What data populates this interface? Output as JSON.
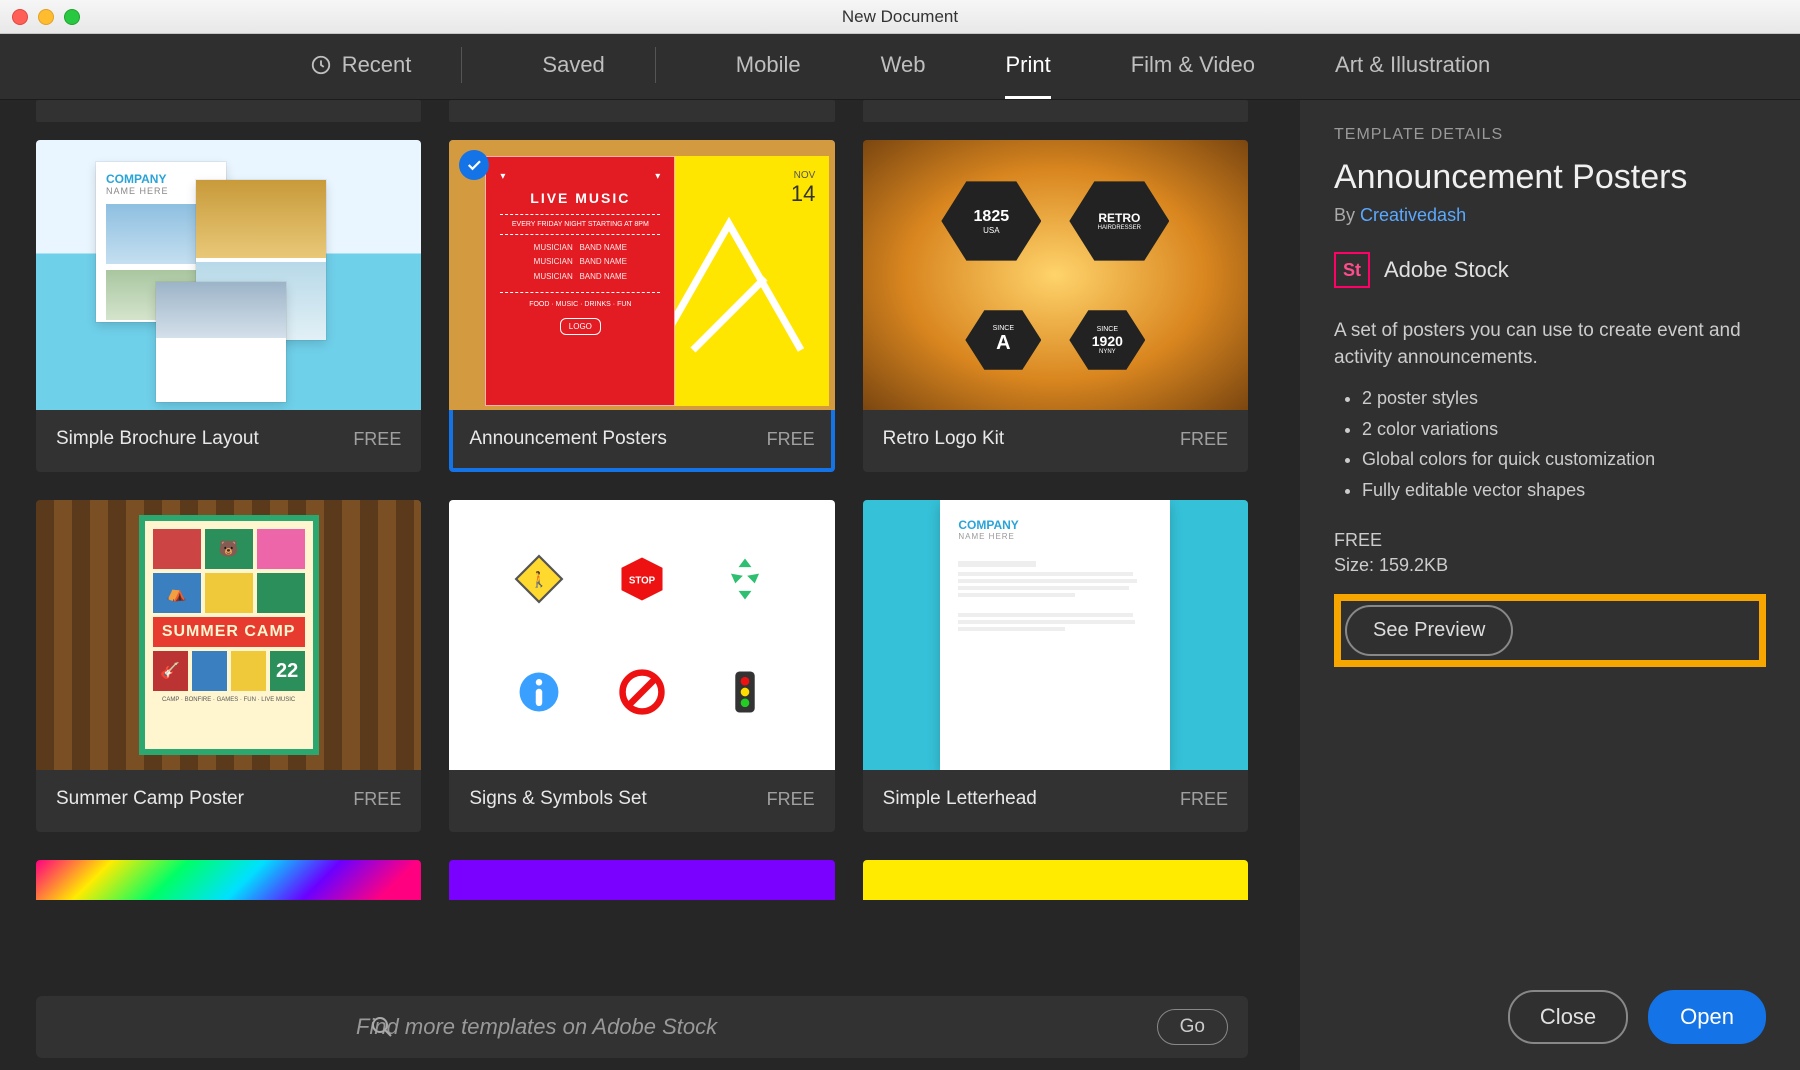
{
  "window": {
    "title": "New Document"
  },
  "tabs": {
    "recent": "Recent",
    "saved": "Saved",
    "mobile": "Mobile",
    "web": "Web",
    "print": "Print",
    "film": "Film & Video",
    "art": "Art & Illustration",
    "active": "print"
  },
  "templates": [
    {
      "id": "brochure",
      "name": "Simple Brochure Layout",
      "price": "FREE",
      "selected": false
    },
    {
      "id": "announce",
      "name": "Announcement Posters",
      "price": "FREE",
      "selected": true
    },
    {
      "id": "retro",
      "name": "Retro Logo Kit",
      "price": "FREE",
      "selected": false
    },
    {
      "id": "summer",
      "name": "Summer Camp Poster",
      "price": "FREE",
      "selected": false
    },
    {
      "id": "signs",
      "name": "Signs & Symbols Set",
      "price": "FREE",
      "selected": false
    },
    {
      "id": "letter",
      "name": "Simple Letterhead",
      "price": "FREE",
      "selected": false
    }
  ],
  "search": {
    "placeholder": "Find more templates on Adobe Stock",
    "go": "Go"
  },
  "details": {
    "heading": "TEMPLATE DETAILS",
    "title": "Announcement Posters",
    "by_prefix": "By ",
    "author": "Creativedash",
    "stock_label": "Adobe Stock",
    "stock_badge": "St",
    "description": "A set of posters you can use to create event and activity announcements.",
    "bullets": [
      "2 poster styles",
      "2 color variations",
      "Global colors for quick customization",
      "Fully editable vector shapes"
    ],
    "price": "FREE",
    "size_label": "Size: 159.2KB",
    "preview": "See Preview"
  },
  "actions": {
    "close": "Close",
    "open": "Open"
  },
  "thumb_text": {
    "announce_header": "LIVE MUSIC",
    "announce_sub": "EVERY FRIDAY NIGHT STARTING AT 8PM",
    "announce_day": "NOV",
    "announce_num": "14",
    "retro_year": "1825",
    "retro_usa": "USA",
    "retro_label": "RETRO",
    "retro_hair": "HAIRDRESSER",
    "retro_a": "A",
    "retro_since": "SINCE",
    "retro_1920": "1920",
    "retro_ny": "NYNY",
    "summer_title": "SUMMER CAMP",
    "summer_num": "22",
    "brochure_company": "COMPANY",
    "brochure_name": "NAME HERE",
    "sym_stop": "STOP"
  }
}
